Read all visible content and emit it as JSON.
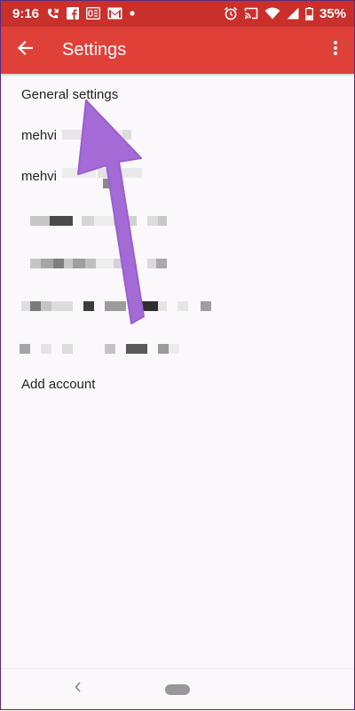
{
  "status_bar": {
    "time": "9:16",
    "battery": "35%",
    "left_icons": [
      "missed-call-icon",
      "facebook-icon",
      "outlook-icon",
      "gmail-icon",
      "notification-dot-icon"
    ],
    "right_icons": [
      "alarm-icon",
      "cast-icon",
      "wifi-icon",
      "signal-icon",
      "battery-icon"
    ]
  },
  "app_bar": {
    "title": "Settings",
    "back_icon": "arrow-back-icon",
    "menu_icon": "more-vert-icon",
    "color": "#df4139"
  },
  "list": {
    "general_settings": "General settings",
    "account_1": "mehvi",
    "account_2": "mehvi",
    "add_account": "Add account"
  },
  "colors": {
    "status_bar": "#c9302c",
    "arrow": "#a46ad6",
    "background": "#fbf8fb"
  }
}
